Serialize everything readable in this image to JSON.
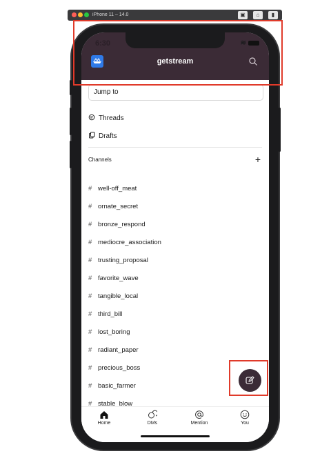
{
  "simulator": {
    "title": "iPhone 11 – 14.0"
  },
  "status_bar": {
    "time": "6:30"
  },
  "header": {
    "title": "getstream"
  },
  "jump_to": {
    "placeholder": "Jump to"
  },
  "nav": {
    "threads": "Threads",
    "drafts": "Drafts"
  },
  "channels": {
    "section_title": "Channels",
    "add_label": "+",
    "items": [
      "well-off_meat",
      "ornate_secret",
      "bronze_respond",
      "mediocre_association",
      "trusting_proposal",
      "favorite_wave",
      "tangible_local",
      "third_bill",
      "lost_boring",
      "radiant_paper",
      "precious_boss",
      "basic_farmer",
      "stable_blow"
    ],
    "prefix": "#"
  },
  "tabs": [
    {
      "label": "Home",
      "icon": "home-icon"
    },
    {
      "label": "DMs",
      "icon": "dms-icon"
    },
    {
      "label": "Mention",
      "icon": "at-icon"
    },
    {
      "label": "You",
      "icon": "smiley-icon"
    }
  ],
  "colors": {
    "header_bg": "#3b2b36",
    "accent_logo": "#2f7ae8",
    "highlight": "#e03a2a"
  }
}
